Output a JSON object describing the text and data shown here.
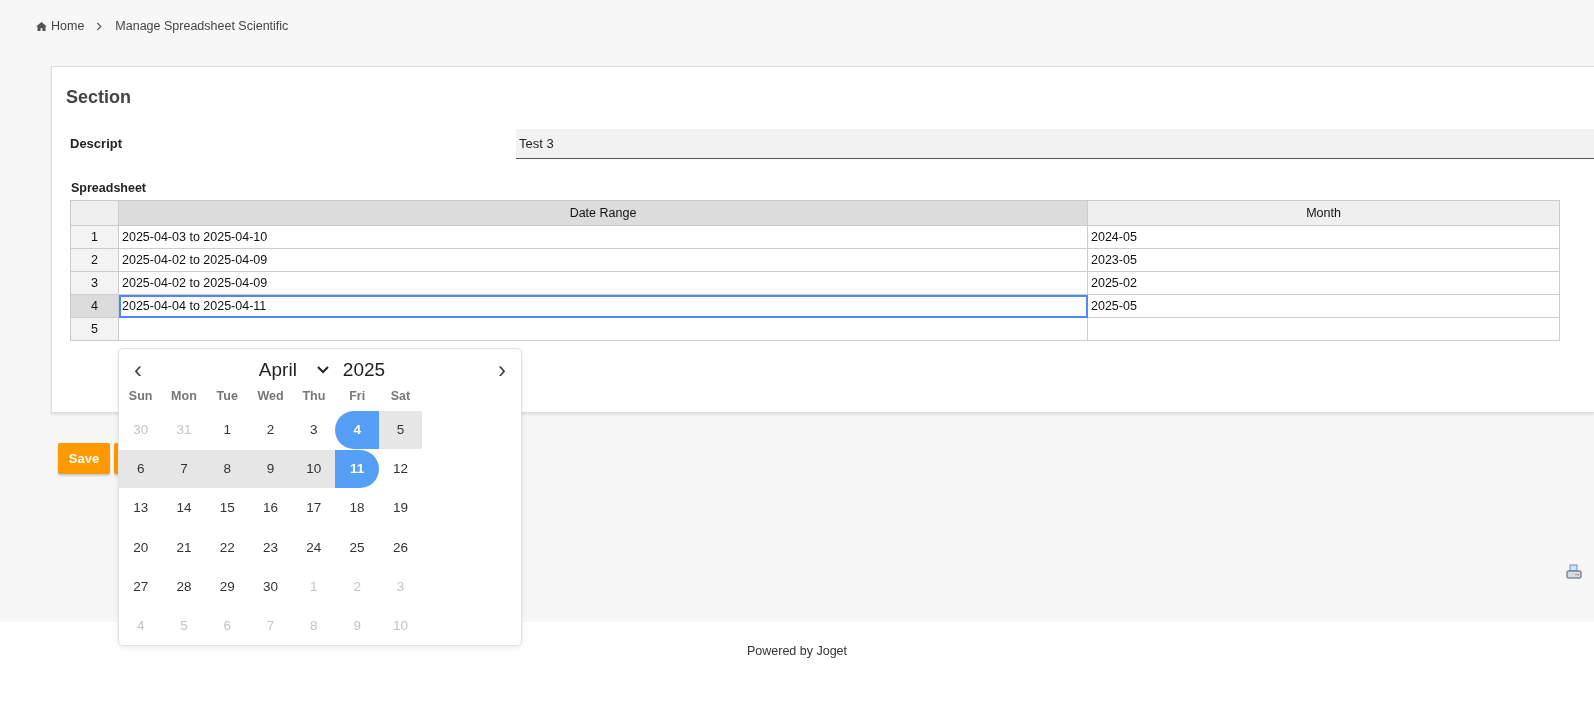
{
  "breadcrumb": [
    {
      "label": "Home",
      "kind": "home"
    },
    {
      "label": "Manage Spreadsheet Scientific",
      "kind": "page"
    }
  ],
  "section": {
    "title": "Section",
    "fields": [
      {
        "label": "Descript",
        "value": "Test 3"
      }
    ],
    "spreadsheet": {
      "label": "Spreadsheet",
      "columns": [
        {
          "label": "Date Range",
          "selected": true
        },
        {
          "label": "Month",
          "selected": false
        }
      ],
      "rows": [
        {
          "number": "1",
          "selected": false,
          "cells": [
            "2025-04-03 to 2025-04-10",
            "2024-05"
          ]
        },
        {
          "number": "2",
          "selected": false,
          "cells": [
            "2025-04-02 to 2025-04-09",
            "2023-05"
          ]
        },
        {
          "number": "3",
          "selected": false,
          "cells": [
            "2025-04-02 to 2025-04-09",
            "2025-02"
          ]
        },
        {
          "number": "4",
          "selected": true,
          "cells": [
            "2025-04-04 to 2025-04-11",
            "2025-05"
          ]
        },
        {
          "number": "5",
          "selected": false,
          "cells": [
            null,
            null
          ]
        }
      ]
    }
  },
  "buttons": [
    {
      "label": "Save",
      "kind": "labeled"
    },
    {
      "kind": "covered"
    }
  ],
  "datepicker": {
    "prev": "‹",
    "next": "›",
    "month": "April",
    "year": "2025",
    "weekdays": [
      "Sun",
      "Mon",
      "Tue",
      "Wed",
      "Thu",
      "Fri",
      "Sat"
    ],
    "weeks": [
      [
        {
          "day": "30",
          "outside": true
        },
        {
          "day": "31",
          "outside": true
        },
        {
          "day": "1"
        },
        {
          "day": "2"
        },
        {
          "day": "3"
        },
        {
          "day": "4",
          "selected": true
        },
        {
          "day": "5",
          "in_range": true
        }
      ],
      [
        {
          "day": "6",
          "in_range": true
        },
        {
          "day": "7",
          "in_range": true
        },
        {
          "day": "8",
          "in_range": true
        },
        {
          "day": "9",
          "in_range": true
        },
        {
          "day": "10",
          "in_range": true
        },
        {
          "day": "11",
          "selected": true
        },
        {
          "day": "12"
        }
      ],
      [
        {
          "day": "13"
        },
        {
          "day": "14"
        },
        {
          "day": "15"
        },
        {
          "day": "16"
        },
        {
          "day": "17"
        },
        {
          "day": "18"
        },
        {
          "day": "19"
        }
      ],
      [
        {
          "day": "20"
        },
        {
          "day": "21"
        },
        {
          "day": "22"
        },
        {
          "day": "23"
        },
        {
          "day": "24"
        },
        {
          "day": "25"
        },
        {
          "day": "26"
        }
      ],
      [
        {
          "day": "27"
        },
        {
          "day": "28"
        },
        {
          "day": "29"
        },
        {
          "day": "30"
        },
        {
          "day": "1",
          "outside": true
        },
        {
          "day": "2",
          "outside": true
        },
        {
          "day": "3",
          "outside": true
        }
      ],
      [
        {
          "day": "4",
          "outside": true
        },
        {
          "day": "5",
          "outside": true
        },
        {
          "day": "6",
          "outside": true
        },
        {
          "day": "7",
          "outside": true
        },
        {
          "day": "8",
          "outside": true
        },
        {
          "day": "9",
          "outside": true
        },
        {
          "day": "10",
          "outside": true
        }
      ]
    ]
  },
  "footer": {
    "text": "Powered by Joget"
  }
}
